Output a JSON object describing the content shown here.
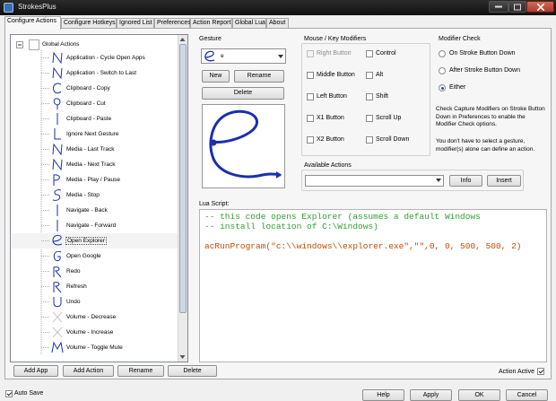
{
  "window": {
    "title": "StrokesPlus",
    "close_icon": "close-icon",
    "minimize_icon": "minimize-icon",
    "maximize_icon": "maximize-icon"
  },
  "tabs": [
    {
      "label": "Configure Actions",
      "active": true
    },
    {
      "label": "Configure Hotkeys"
    },
    {
      "label": "Ignored List"
    },
    {
      "label": "Preferences"
    },
    {
      "label": "Action Report"
    },
    {
      "label": "Global Lua"
    },
    {
      "label": "About"
    }
  ],
  "tree": {
    "root": "Global Actions",
    "items": [
      {
        "label": "Application - Cycle Open Apps",
        "icon": "gesture-n"
      },
      {
        "label": "Application - Switch to Last",
        "icon": "gesture-n"
      },
      {
        "label": "Clipboard - Copy",
        "icon": "gesture-c"
      },
      {
        "label": "Clipboard - Cut",
        "icon": "gesture-loop"
      },
      {
        "label": "Clipboard - Paste",
        "icon": "gesture-line"
      },
      {
        "label": "Ignore Next Gesture",
        "icon": "gesture-l"
      },
      {
        "label": "Media - Last Track",
        "icon": "gesture-n"
      },
      {
        "label": "Media - Next Track",
        "icon": "gesture-n"
      },
      {
        "label": "Media - Play / Pause",
        "icon": "gesture-p"
      },
      {
        "label": "Media - Stop",
        "icon": "gesture-s"
      },
      {
        "label": "Navigate - Back",
        "icon": "gesture-line"
      },
      {
        "label": "Navigate - Forward",
        "icon": "gesture-line"
      },
      {
        "label": "Open Explorer",
        "icon": "gesture-e",
        "selected": true
      },
      {
        "label": "Open Google",
        "icon": "gesture-g"
      },
      {
        "label": "Redo",
        "icon": "gesture-r"
      },
      {
        "label": "Refresh",
        "icon": "gesture-r"
      },
      {
        "label": "Undo",
        "icon": "gesture-u"
      },
      {
        "label": "Volume - Decrease",
        "icon": "gesture-x"
      },
      {
        "label": "Volume - Increase",
        "icon": "gesture-x"
      },
      {
        "label": "Volume - Toggle Mute",
        "icon": "gesture-m"
      }
    ]
  },
  "left_buttons": {
    "add_app": "Add App",
    "add_action": "Add Action",
    "rename": "Rename",
    "delete": "Delete"
  },
  "gesture": {
    "label": "Gesture",
    "selected": "e",
    "new": "New",
    "rename": "Rename",
    "delete": "Delete"
  },
  "modifiers": {
    "label": "Mouse / Key Modifiers",
    "left_col": [
      {
        "label": "Right Button",
        "disabled": true
      },
      {
        "label": "Middle Button"
      },
      {
        "label": "Left Button"
      },
      {
        "label": "X1 Button"
      },
      {
        "label": "X2 Button"
      }
    ],
    "right_col": [
      {
        "label": "Control"
      },
      {
        "label": "Alt"
      },
      {
        "label": "Shift"
      },
      {
        "label": "Scroll Up"
      },
      {
        "label": "Scroll Down"
      }
    ]
  },
  "modifier_check": {
    "label": "Modifier Check",
    "options": [
      "On Stroke Button Down",
      "After Stroke Button Down",
      "Either"
    ],
    "selected": "Either",
    "note1": [
      "Check Capture Modifiers on Stroke Button",
      "Down in Preferences to enable the",
      "Modifier Check options."
    ],
    "note2": [
      "You don't have to select a gesture,",
      "modifier(s) alone can define an action."
    ]
  },
  "available_actions": {
    "label": "Available Actions",
    "value": "",
    "info": "Info",
    "insert": "Insert"
  },
  "lua": {
    "label": "Lua Script:",
    "comment1": "-- this code opens Explorer (assumes a default Windows",
    "comment2": "-- install location of C:\\Windows)",
    "line_fn": "acRunProgram(",
    "line_args": "\"c:\\\\windows\\\\explorer.exe\",\"\",0, 0, 500, 500, 2)"
  },
  "action_active": {
    "label": "Action Active",
    "checked": true
  },
  "footer": {
    "auto_save": "Auto Save",
    "auto_save_checked": true,
    "help": "Help",
    "apply": "Apply",
    "ok": "OK",
    "cancel": "Cancel"
  },
  "colors": {
    "accent": "#2255bb",
    "gesture_stroke": "#1a2fb0",
    "comment": "#2ea02e"
  }
}
